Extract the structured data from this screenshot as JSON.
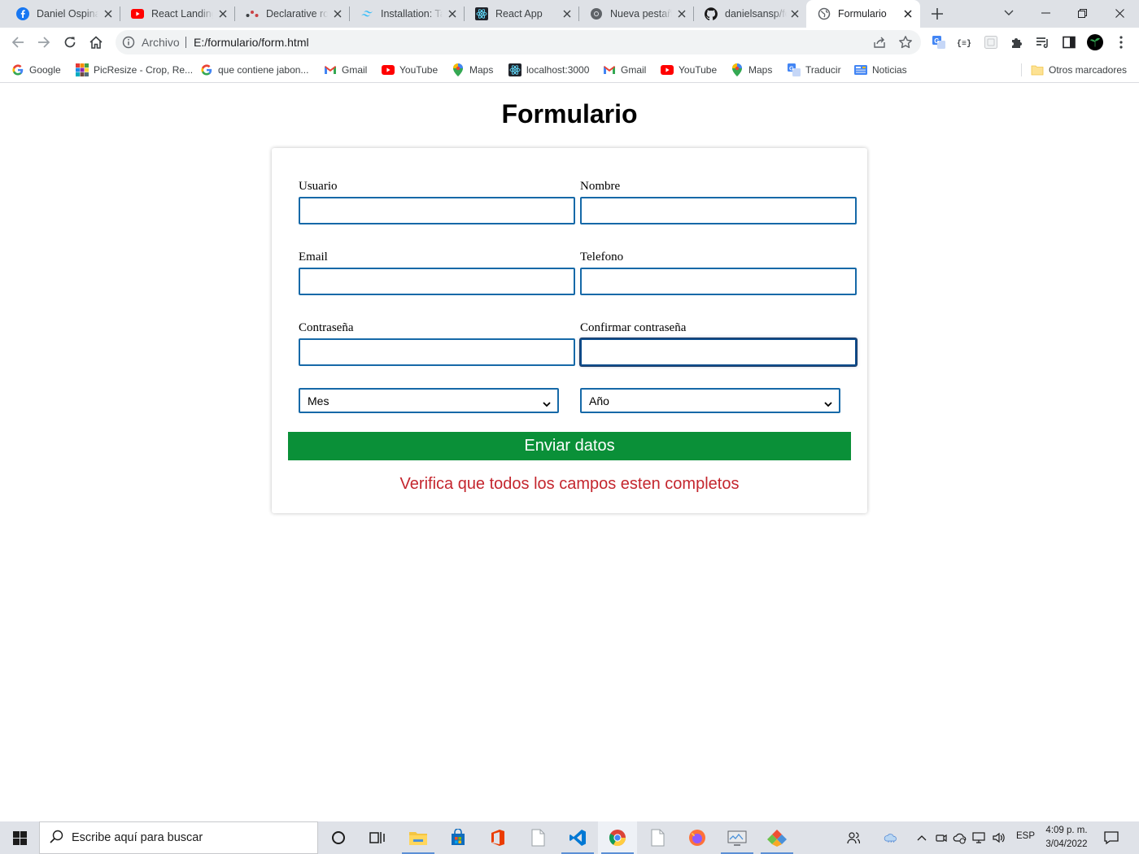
{
  "browser": {
    "tabs": [
      {
        "title": "Daniel Ospina",
        "icon": "facebook-icon",
        "color": "#1877f2"
      },
      {
        "title": "React Landing",
        "icon": "youtube-icon",
        "color": "#ff0000"
      },
      {
        "title": "Declarative ro",
        "icon": "react-router-icon",
        "color": "#ca4245"
      },
      {
        "title": "Installation: Ta",
        "icon": "tailwind-icon",
        "color": "#38bdf8"
      },
      {
        "title": "React App",
        "icon": "react-icon",
        "color": "#61dafb"
      },
      {
        "title": "Nueva pestaña",
        "icon": "chrome-icon",
        "color": "#5f6368"
      },
      {
        "title": "danielsansp/fo",
        "icon": "github-icon",
        "color": "#181717"
      },
      {
        "title": "Formulario",
        "icon": "globe-icon",
        "color": "#5f6368",
        "active": true
      }
    ],
    "address": {
      "scheme_label": "Archivo",
      "url": "E:/formulario/form.html"
    },
    "bookmarks": [
      {
        "label": "Google",
        "icon": "google-icon"
      },
      {
        "label": "PicResize - Crop, Re...",
        "icon": "picresize-icon"
      },
      {
        "label": "que contiene jabon...",
        "icon": "google-icon"
      },
      {
        "label": "Gmail",
        "icon": "gmail-icon"
      },
      {
        "label": "YouTube",
        "icon": "youtube-icon"
      },
      {
        "label": "Maps",
        "icon": "maps-icon"
      },
      {
        "label": "localhost:3000",
        "icon": "react-icon"
      },
      {
        "label": "Gmail",
        "icon": "gmail-icon"
      },
      {
        "label": "YouTube",
        "icon": "youtube-icon"
      },
      {
        "label": "Maps",
        "icon": "maps-icon"
      },
      {
        "label": "Traducir",
        "icon": "translate-icon"
      },
      {
        "label": "Noticias",
        "icon": "news-icon"
      }
    ],
    "other_bookmarks": "Otros marcadores"
  },
  "page": {
    "title": "Formulario",
    "form": {
      "fields": {
        "usuario": {
          "label": "Usuario",
          "value": ""
        },
        "nombre": {
          "label": "Nombre",
          "value": ""
        },
        "email": {
          "label": "Email",
          "value": ""
        },
        "telefono": {
          "label": "Telefono",
          "value": ""
        },
        "password": {
          "label": "Contraseña",
          "value": ""
        },
        "confirm": {
          "label": "Confirmar contraseña",
          "value": ""
        }
      },
      "month_select": {
        "selected": "Mes"
      },
      "year_select": {
        "selected": "Año"
      },
      "submit_label": "Enviar datos",
      "error_message": "Verifica que todos los campos esten completos"
    },
    "colors": {
      "submit_bg": "#0a9038",
      "error_text": "#c4262e",
      "input_border": "#1669a8"
    }
  },
  "taskbar": {
    "search_placeholder": "Escribe aquí para buscar",
    "language": "ESP",
    "time": "4:09 p. m.",
    "date": "3/04/2022"
  }
}
